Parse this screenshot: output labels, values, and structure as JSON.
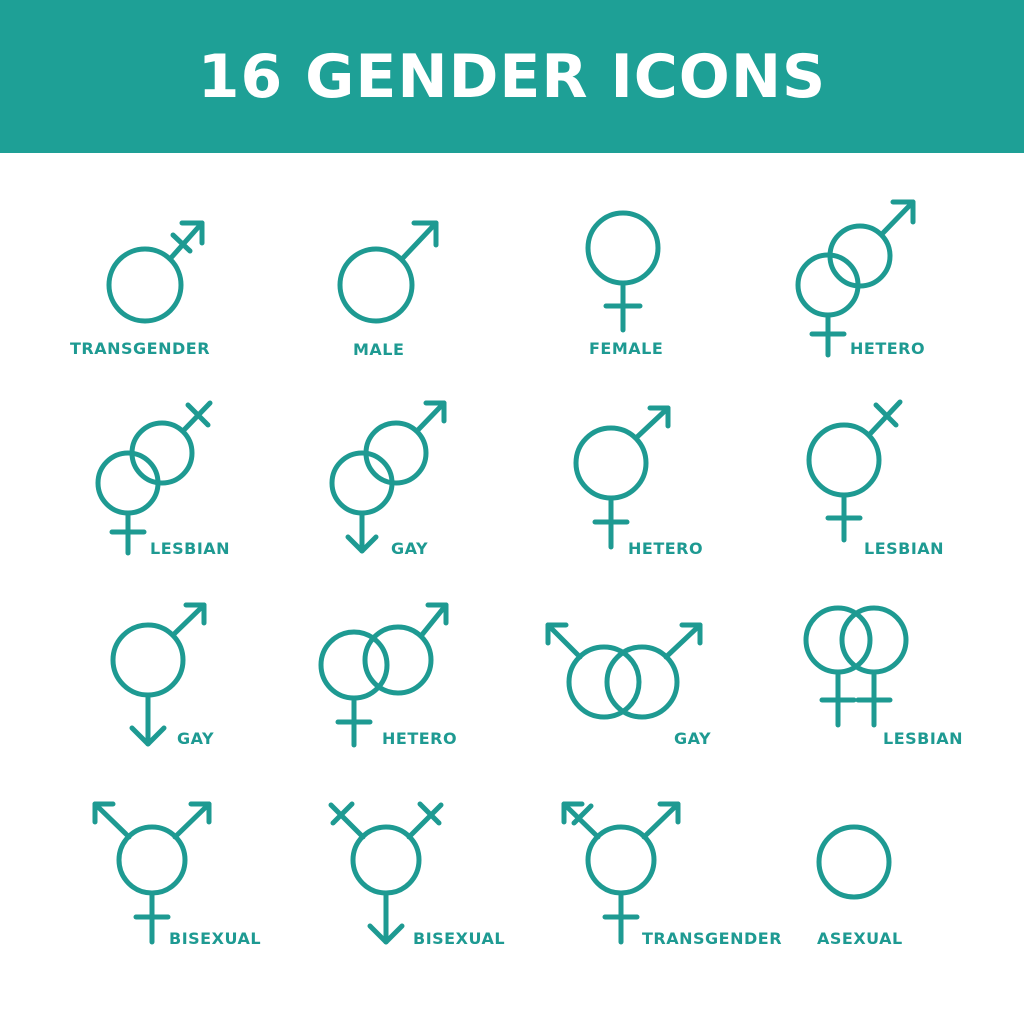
{
  "header": {
    "title": "16 GENDER ICONS",
    "background_color": "#1ea096",
    "title_color": "#ffffff"
  },
  "icon_color": "#1e9a92",
  "icons": [
    {
      "label": "TRANSGENDER",
      "symbol": "transgender-icon"
    },
    {
      "label": "MALE",
      "symbol": "male-icon"
    },
    {
      "label": "FEMALE",
      "symbol": "female-icon"
    },
    {
      "label": "HETERO",
      "symbol": "hetero-icon"
    },
    {
      "label": "LESBIAN",
      "symbol": "lesbian-icon"
    },
    {
      "label": "GAY",
      "symbol": "gay-icon"
    },
    {
      "label": "HETERO",
      "symbol": "hetero-icon"
    },
    {
      "label": "LESBIAN",
      "symbol": "lesbian-icon"
    },
    {
      "label": "GAY",
      "symbol": "gay-icon"
    },
    {
      "label": "HETERO",
      "symbol": "hetero-icon"
    },
    {
      "label": "GAY",
      "symbol": "gay-icon"
    },
    {
      "label": "LESBIAN",
      "symbol": "lesbian-icon"
    },
    {
      "label": "BISEXUAL",
      "symbol": "bisexual-icon"
    },
    {
      "label": "BISEXUAL",
      "symbol": "bisexual-icon"
    },
    {
      "label": "TRANSGENDER",
      "symbol": "transgender-icon"
    },
    {
      "label": "ASEXUAL",
      "symbol": "asexual-icon"
    }
  ]
}
